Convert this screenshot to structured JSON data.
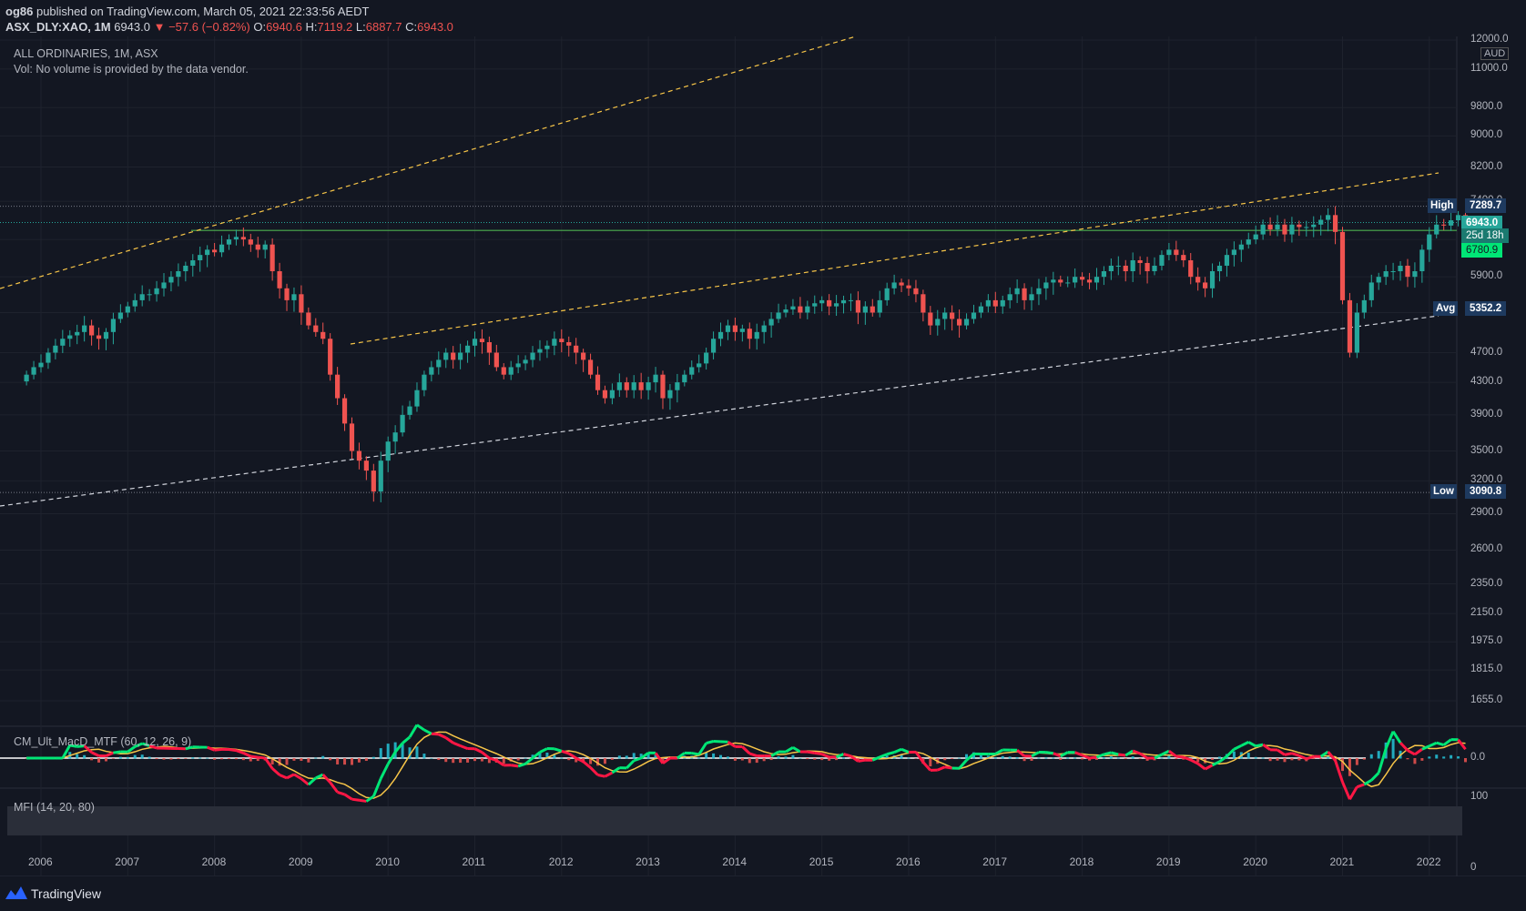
{
  "header": {
    "publisher": "og86",
    "published_text": "published on TradingView.com, March 05, 2021 22:33:56 AEDT",
    "symbol": "ASX_DLY:XAO, 1M",
    "last": "6943.0",
    "change": "▼ −57.6 (−0.82%)",
    "o_label": "O:",
    "o": "6940.6",
    "h_label": "H:",
    "h": "7119.2",
    "l_label": "L:",
    "l": "6887.7",
    "c_label": "C:",
    "c": "6943.0"
  },
  "legend": {
    "instrument": "ALL ORDINARIES, 1M, ASX",
    "volume_note": "Vol: No volume is provided by the data vendor.",
    "macd": "CM_Ult_MacD_MTF (60, 12, 26, 9)",
    "mfi": "MFI (14, 20, 80)"
  },
  "price_axis": {
    "currency": "AUD",
    "ticks": [
      "12000.0",
      "11000.0",
      "9800.0",
      "9000.0",
      "8200.0",
      "7400.0",
      "6600.0",
      "5900.0",
      "5300.0",
      "4700.0",
      "4300.0",
      "3900.0",
      "3500.0",
      "3200.0",
      "2900.0",
      "2600.0",
      "2350.0",
      "2150.0",
      "1975.0",
      "1815.0",
      "1655.0"
    ],
    "macd_tick": "0.0",
    "mfi_ticks": [
      "100",
      "0"
    ]
  },
  "tags": {
    "high_label": "High",
    "high_value": "7289.7",
    "last_value": "6943.0",
    "countdown": "25d 18h",
    "level_value": "6780.9",
    "avg_label": "Avg",
    "avg_value": "5352.2",
    "low_label": "Low",
    "low_value": "3090.8"
  },
  "time_axis": [
    "2006",
    "2007",
    "2008",
    "2009",
    "2010",
    "2011",
    "2012",
    "2013",
    "2014",
    "2015",
    "2016",
    "2017",
    "2018",
    "2019",
    "2020",
    "2021",
    "2022"
  ],
  "footer": {
    "brand": "TradingView"
  },
  "colors": {
    "background": "#131722",
    "up": "#26a69a",
    "down": "#ef5350",
    "trend": "#f7c548",
    "level": "#4caf50"
  },
  "chart_data": {
    "type": "candlestick",
    "scale": "log",
    "ylim": [
      1550,
      12000
    ],
    "series": [
      {
        "name": "ALL ORDINARIES",
        "x_start": "2005-11",
        "interval": "1M",
        "close": [
          4400,
          4500,
          4560,
          4700,
          4800,
          4900,
          4950,
          5000,
          5100,
          4950,
          4900,
          5000,
          5200,
          5300,
          5400,
          5500,
          5600,
          5600,
          5700,
          5800,
          5900,
          6000,
          6100,
          6200,
          6300,
          6400,
          6350,
          6500,
          6600,
          6650,
          6600,
          6500,
          6400,
          6500,
          6000,
          5700,
          5500,
          5600,
          5300,
          5100,
          5000,
          4900,
          4400,
          4100,
          3800,
          3500,
          3400,
          3300,
          3100,
          3400,
          3600,
          3700,
          3900,
          4000,
          4200,
          4400,
          4500,
          4600,
          4700,
          4600,
          4700,
          4800,
          4900,
          4850,
          4700,
          4500,
          4400,
          4500,
          4550,
          4600,
          4700,
          4750,
          4800,
          4900,
          4850,
          4800,
          4700,
          4600,
          4400,
          4200,
          4100,
          4200,
          4300,
          4200,
          4300,
          4200,
          4300,
          4400,
          4100,
          4200,
          4300,
          4400,
          4500,
          4550,
          4700,
          4900,
          5000,
          5100,
          5000,
          5050,
          4900,
          5000,
          5100,
          5200,
          5300,
          5350,
          5400,
          5300,
          5400,
          5450,
          5500,
          5400,
          5450,
          5500,
          5500,
          5300,
          5400,
          5300,
          5500,
          5700,
          5800,
          5750,
          5700,
          5600,
          5300,
          5100,
          5200,
          5300,
          5200,
          5100,
          5200,
          5300,
          5400,
          5500,
          5400,
          5500,
          5600,
          5700,
          5500,
          5600,
          5700,
          5800,
          5850,
          5800,
          5800,
          5900,
          5850,
          5800,
          5900,
          6000,
          6100,
          6100,
          6000,
          6200,
          6150,
          6000,
          6100,
          6300,
          6400,
          6300,
          6200,
          5900,
          5800,
          5700,
          6000,
          6100,
          6300,
          6400,
          6500,
          6600,
          6700,
          6900,
          6800,
          6900,
          6700,
          6900,
          6850,
          6850,
          6900,
          7000,
          7100,
          6750,
          5500,
          4700,
          5300,
          5500,
          5800,
          5900,
          6000,
          6000,
          6100,
          5900,
          6000,
          6400,
          6700,
          6900,
          6880,
          6990,
          7100,
          6943
        ]
      }
    ],
    "levels": {
      "high": 7289.7,
      "last": 6943.0,
      "horizontal": 6780.9,
      "avg": 5352.2,
      "low": 3090.8
    }
  }
}
